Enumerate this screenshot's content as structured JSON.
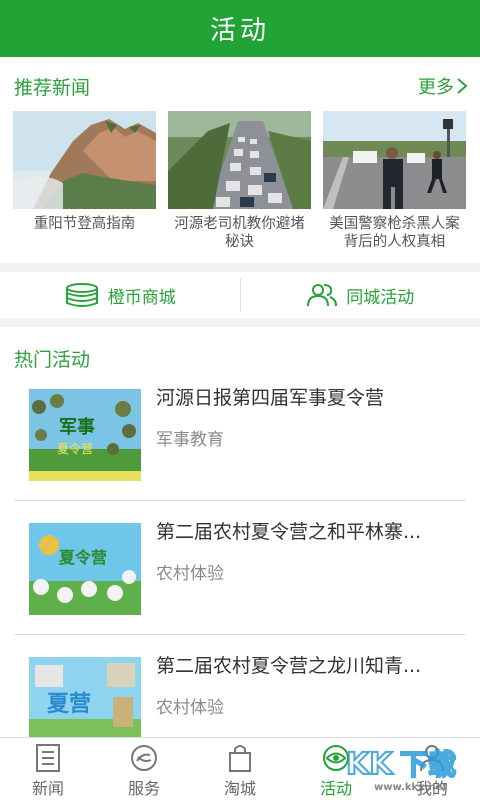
{
  "header": {
    "title": "活动"
  },
  "news": {
    "heading": "推荐新闻",
    "more_label": "更多",
    "items": [
      {
        "caption": "重阳节登高指南"
      },
      {
        "caption": "河源老司机教你避堵秘诀"
      },
      {
        "caption": "美国警察枪杀黑人案背后的人权真相"
      }
    ]
  },
  "shortcuts": [
    {
      "label": "橙币商城",
      "icon": "coins-icon"
    },
    {
      "label": "同城活动",
      "icon": "people-icon"
    }
  ],
  "hot": {
    "heading": "热门活动",
    "items": [
      {
        "title": "河源日报第四届军事夏令营",
        "tag": "军事教育"
      },
      {
        "title": "第二届农村夏令营之和平林寨...",
        "tag": "农村体验"
      },
      {
        "title": "第二届农村夏令营之龙川知青...",
        "tag": "农村体验"
      }
    ]
  },
  "tabbar": {
    "active": "活动",
    "tabs": [
      {
        "label": "新闻",
        "icon": "newspaper-icon"
      },
      {
        "label": "服务",
        "icon": "service-icon"
      },
      {
        "label": "淘城",
        "icon": "shopping-bag-icon"
      },
      {
        "label": "活动",
        "icon": "eye-icon"
      },
      {
        "label": "我的",
        "icon": "user-icon"
      }
    ]
  },
  "colors": {
    "brand": "#21a336",
    "accent_text": "#2aa33a"
  },
  "watermark": {
    "text": "KK下载",
    "url": "www.kkx.net"
  }
}
